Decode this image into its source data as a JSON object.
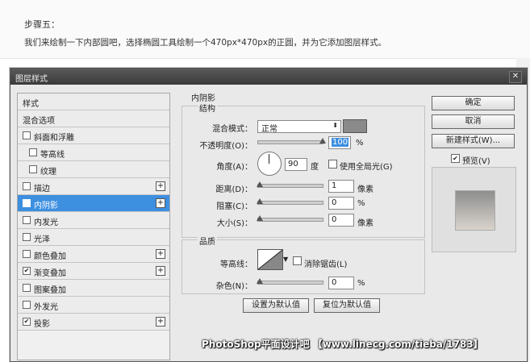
{
  "article": {
    "step": "步骤五：",
    "desc": "我们来绘制一下内部圆吧，选择椭圆工具绘制一个470px*470px的正圆，并为它添加图层样式。"
  },
  "dialog": {
    "title": "图层样式",
    "close_glyph": "✕",
    "left_items": [
      {
        "label": "样式"
      },
      {
        "label": "混合选项"
      },
      {
        "label": "斜面和浮雕",
        "checked": false
      },
      {
        "label": "等高线",
        "checked": false
      },
      {
        "label": "纹理",
        "checked": false
      },
      {
        "label": "描边",
        "checked": false,
        "plus": "+"
      },
      {
        "label": "内阴影",
        "checked": true,
        "plus": "+"
      },
      {
        "label": "内发光",
        "checked": false
      },
      {
        "label": "光泽",
        "checked": false
      },
      {
        "label": "颜色叠加",
        "checked": false,
        "plus": "+"
      },
      {
        "label": "渐变叠加",
        "checked": true,
        "plus": "+"
      },
      {
        "label": "图案叠加",
        "checked": false
      },
      {
        "label": "外发光",
        "checked": false
      },
      {
        "label": "投影",
        "checked": true,
        "plus": "+"
      }
    ],
    "inner_shadow": {
      "section_title": "内阴影",
      "structure_title": "结构",
      "blend_mode_label": "混合模式：",
      "blend_mode_value": "正常",
      "opacity_label": "不透明度(O)：",
      "opacity_value": "100",
      "opacity_unit": "%",
      "angle_label": "角度(A)：",
      "angle_value": "90",
      "angle_unit": "度",
      "global_light_label": "使用全局光(G)",
      "distance_label": "距离(D)：",
      "distance_value": "1",
      "distance_unit": "像素",
      "choke_label": "阻塞(C)：",
      "choke_value": "0",
      "choke_unit": "%",
      "size_label": "大小(S)：",
      "size_value": "0",
      "size_unit": "像素",
      "quality_title": "品质",
      "contour_label": "等高线：",
      "antialias_label": "消除锯齿(L)",
      "noise_label": "杂色(N)：",
      "noise_value": "0",
      "noise_unit": "%",
      "make_default": "设置为默认值",
      "reset_default": "复位为默认值"
    },
    "buttons": {
      "ok": "确定",
      "cancel": "取消",
      "new_style": "新建样式(W)...",
      "preview_label": "预览(V)",
      "preview_checked": "✔"
    },
    "check_glyph": "✔"
  },
  "watermark": "PhotoShop平面设计吧 【www.linecg.com/tieba/1783】"
}
